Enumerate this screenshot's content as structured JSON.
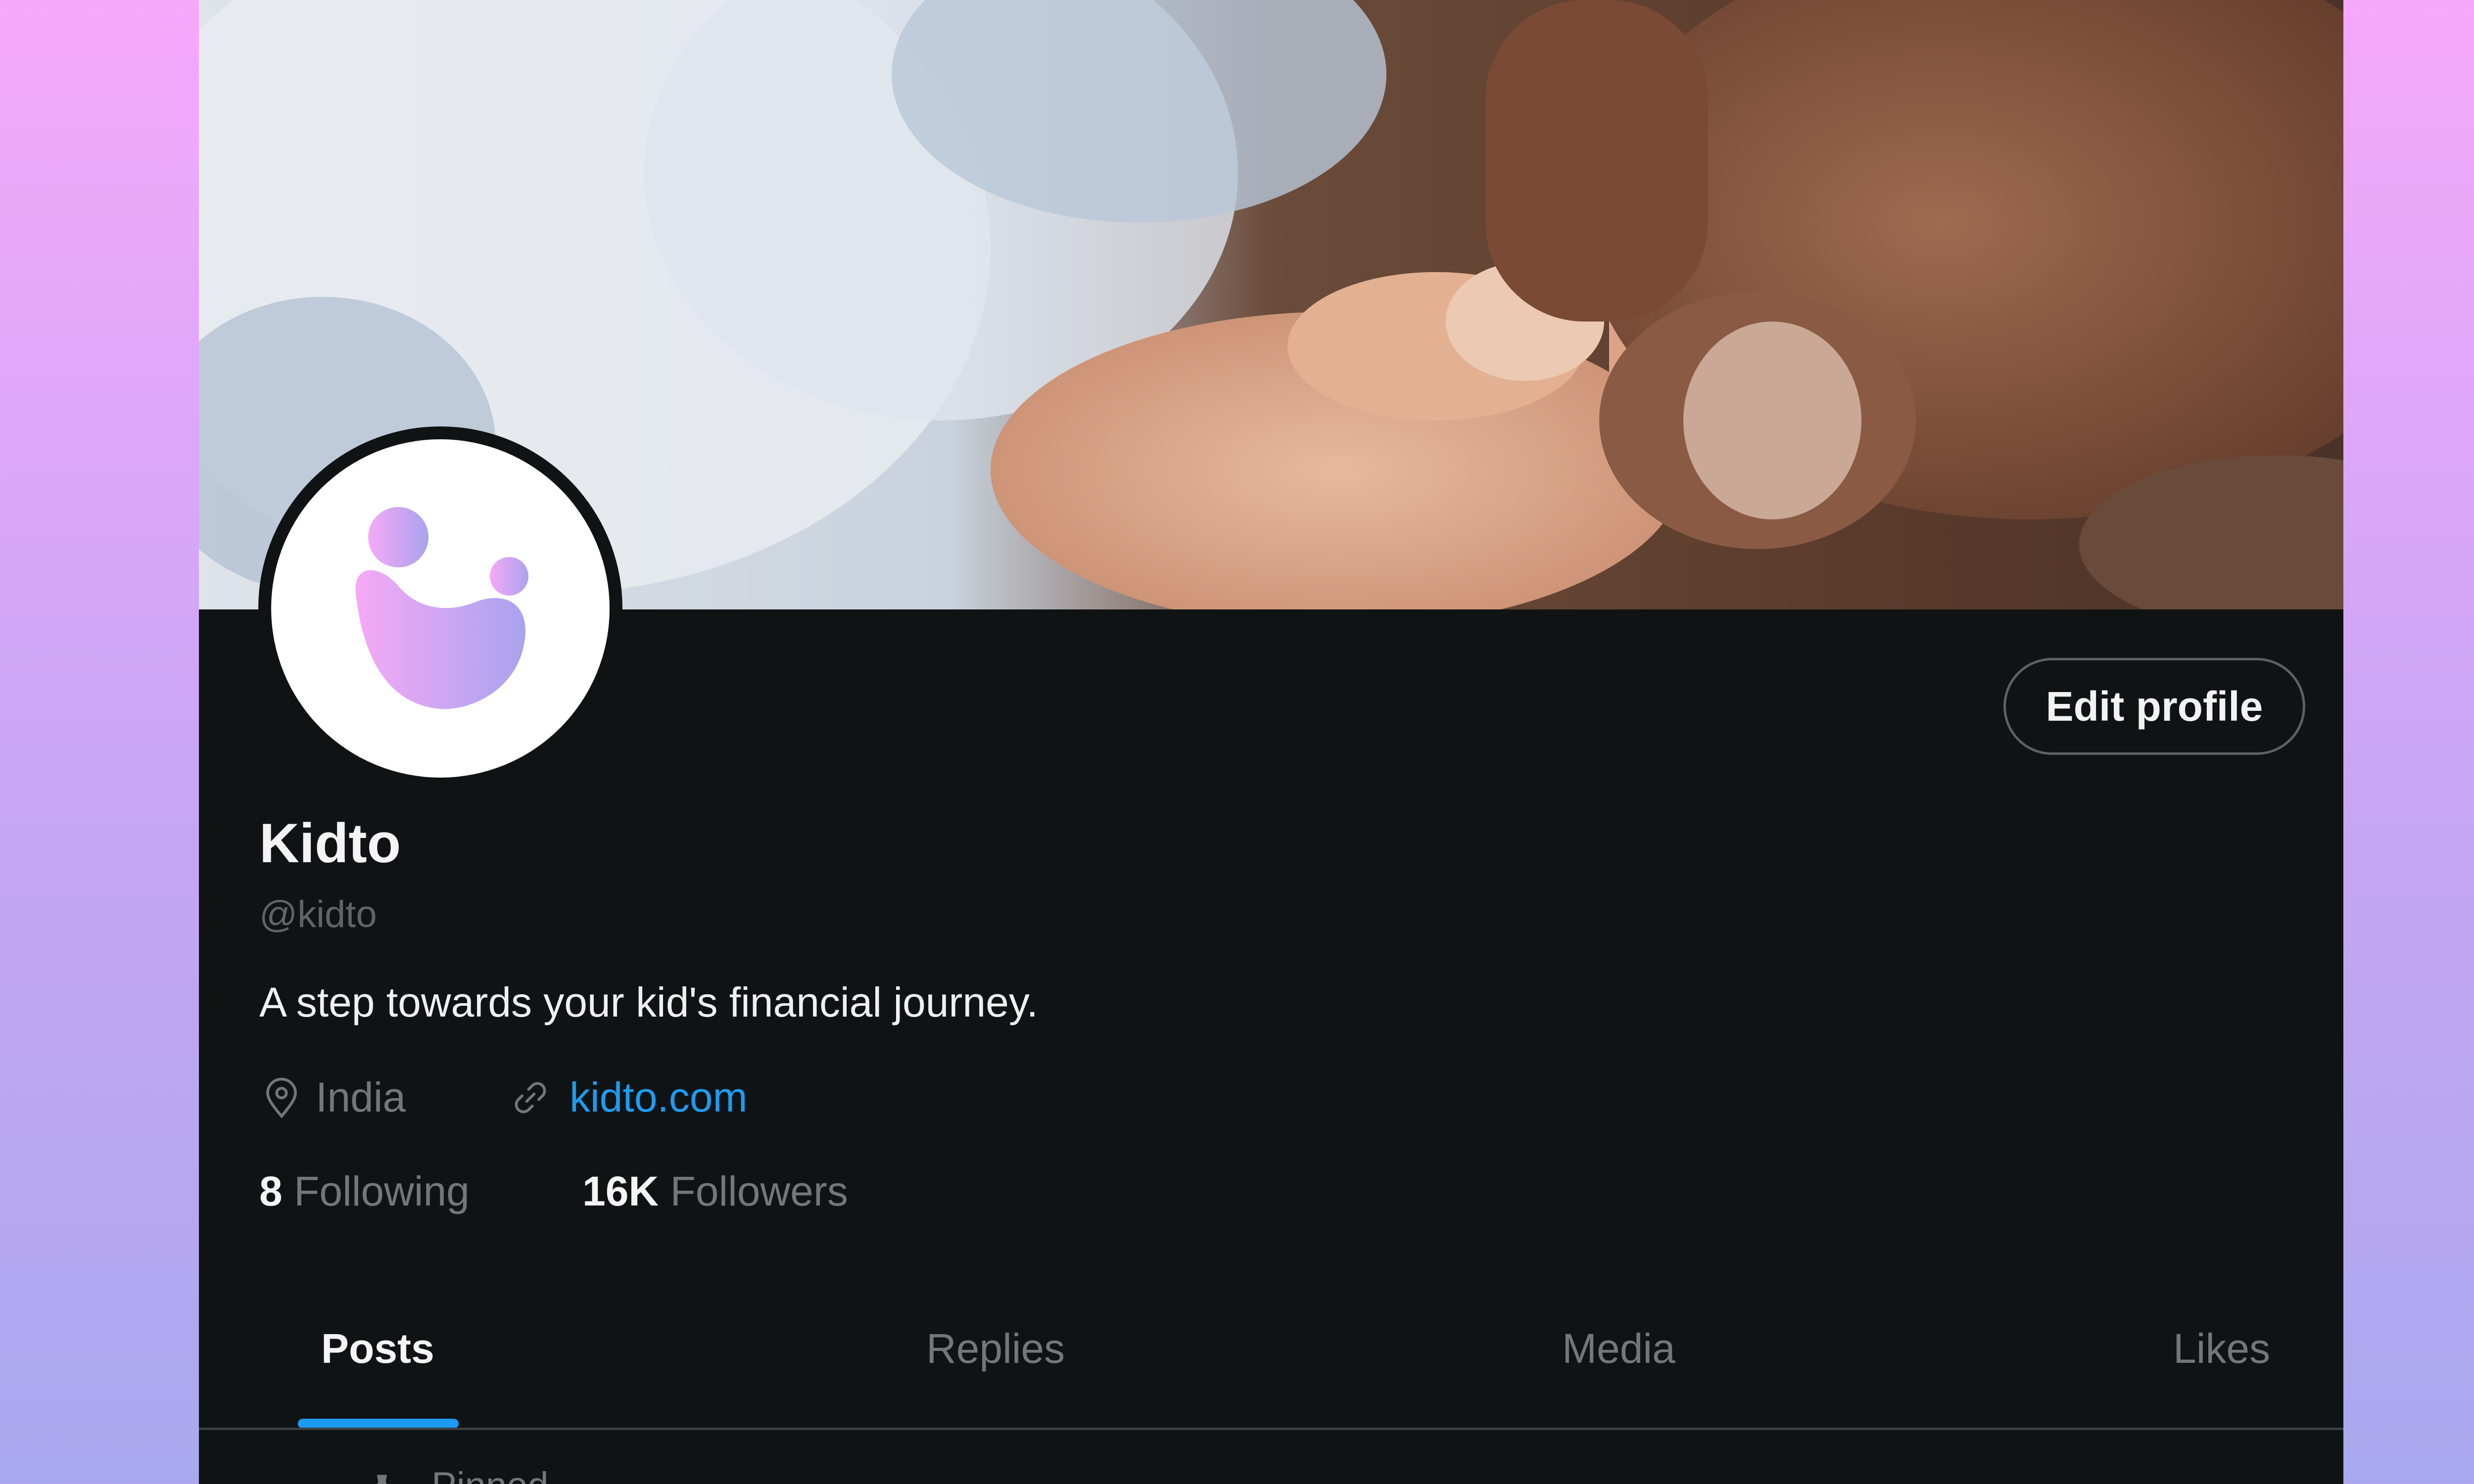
{
  "profile": {
    "name": "Kidto",
    "handle": "@kidto",
    "bio": "A step towards your kid's financial journey.",
    "location": "India",
    "website": "kidto.com",
    "following_count": "8",
    "following_label": "Following",
    "followers_count": "16K",
    "followers_label": "Followers"
  },
  "actions": {
    "edit_profile": "Edit profile"
  },
  "tabs": [
    {
      "label": "Posts",
      "active": true
    },
    {
      "label": "Replies",
      "active": false
    },
    {
      "label": "Media",
      "active": false
    },
    {
      "label": "Likes",
      "active": false
    }
  ],
  "pinned_label": "Pinned",
  "icons": {
    "location": "location-pin-icon",
    "link": "link-icon",
    "pin": "pin-icon"
  },
  "colors": {
    "accent": "#1d9bf0",
    "background": "#101313",
    "logo_gradient_start": "#f5a9f6",
    "logo_gradient_end": "#a9a3ee"
  }
}
